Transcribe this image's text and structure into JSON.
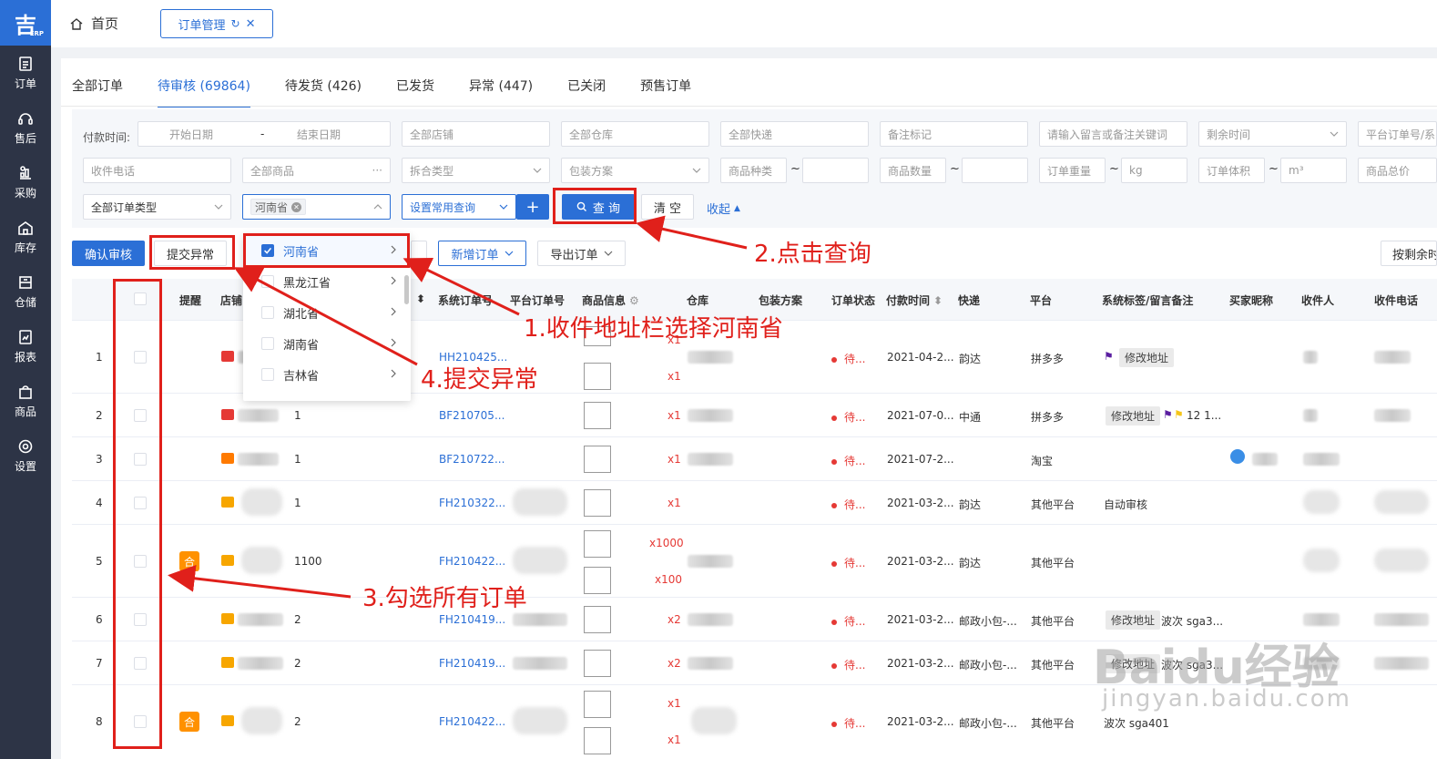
{
  "sidebar": {
    "logo": "吉",
    "logo_sub": "ERP",
    "items": [
      {
        "label": "订单",
        "icon": "order-icon"
      },
      {
        "label": "售后",
        "icon": "headset-icon"
      },
      {
        "label": "采购",
        "icon": "purchase-icon"
      },
      {
        "label": "库存",
        "icon": "warehouse-icon"
      },
      {
        "label": "仓储",
        "icon": "storage-icon"
      },
      {
        "label": "报表",
        "icon": "report-icon"
      },
      {
        "label": "商品",
        "icon": "goods-icon"
      },
      {
        "label": "设置",
        "icon": "settings-icon"
      }
    ]
  },
  "header": {
    "home": "首页",
    "open_tab": "订单管理"
  },
  "tabs": [
    "全部订单",
    "待审核 (69864)",
    "待发货 (426)",
    "已发货",
    "异常 (447)",
    "已关闭",
    "预售订单"
  ],
  "filters": {
    "pay_time_label": "付款时间:",
    "start_date": "开始日期",
    "date_sep": "-",
    "end_date": "结束日期",
    "all_shops": "全部店铺",
    "all_warehouses": "全部仓库",
    "all_express": "全部快递",
    "remark_flag": "备注标记",
    "keyword": "请输入留言或备注关键词",
    "remaining_time": "剩余时间",
    "platform_order": "平台订单号/系",
    "phone": "收件电话",
    "all_goods": "全部商品",
    "split_type": "拆合类型",
    "package_plan": "包装方案",
    "goods_kinds": "商品种类",
    "goods_count": "商品数量",
    "order_weight": "订单重量",
    "weight_unit": "kg",
    "order_volume": "订单体积",
    "volume_unit": "m³",
    "goods_total": "商品总价",
    "tilde": "~",
    "all_order_types": "全部订单类型",
    "province_chip": "河南省",
    "common_query": "设置常用查询",
    "query_btn": "查 询",
    "clear_btn": "清 空",
    "collapse": "收起"
  },
  "actions": {
    "confirm_review": "确认审核",
    "submit_exception": "提交异常",
    "new_order": "新增订单",
    "export_order": "导出订单",
    "by_remaining": "按剩余时"
  },
  "dropdown": {
    "items": [
      "河南省",
      "黑龙江省",
      "湖北省",
      "湖南省",
      "吉林省"
    ]
  },
  "table": {
    "headers": [
      "提醒",
      "店铺",
      "系统订单号",
      "平台订单号",
      "商品信息",
      "仓库",
      "包装方案",
      "订单状态",
      "付款时间",
      "快递",
      "平台",
      "系统标签/留言备注",
      "买家昵称",
      "收件人",
      "收件电话"
    ],
    "rows": [
      {
        "idx": "1",
        "qty": "",
        "sys_no": "HH210425...",
        "counts": [
          "x1",
          "x1"
        ],
        "status": "待...",
        "pay": "2021-04-2...",
        "express": "韵达",
        "platform": "拼多多",
        "tags": "修改地址",
        "merged": false
      },
      {
        "idx": "2",
        "qty": "1",
        "sys_no": "BF210705...",
        "counts": [
          "x1"
        ],
        "status": "待...",
        "pay": "2021-07-0...",
        "express": "中通",
        "platform": "拼多多",
        "tags": "修改地址",
        "tag_extra": "12 1...",
        "merged": false
      },
      {
        "idx": "3",
        "qty": "1",
        "sys_no": "BF210722...",
        "counts": [
          "x1"
        ],
        "status": "待...",
        "pay": "2021-07-2...",
        "express": "",
        "platform": "淘宝",
        "tags": "",
        "merged": false
      },
      {
        "idx": "4",
        "qty": "1",
        "sys_no": "FH210322...",
        "counts": [
          "x1"
        ],
        "status": "待...",
        "pay": "2021-03-2...",
        "express": "韵达",
        "platform": "其他平台",
        "tags": "自动审核",
        "merged": false
      },
      {
        "idx": "5",
        "qty": "1100",
        "sys_no": "FH210422...",
        "counts": [
          "x1000",
          "x100"
        ],
        "status": "待...",
        "pay": "2021-03-2...",
        "express": "韵达",
        "platform": "其他平台",
        "tags": "",
        "merged": true
      },
      {
        "idx": "6",
        "qty": "2",
        "sys_no": "FH210419...",
        "counts": [
          "x2"
        ],
        "status": "待...",
        "pay": "2021-03-2...",
        "express": "邮政小包-...",
        "platform": "其他平台",
        "tags": "修改地址",
        "tag_extra": "波次 sga3...",
        "merged": false
      },
      {
        "idx": "7",
        "qty": "2",
        "sys_no": "FH210419...",
        "counts": [
          "x2"
        ],
        "status": "待...",
        "pay": "2021-03-2...",
        "express": "邮政小包-...",
        "platform": "其他平台",
        "tags": "修改地址",
        "tag_extra": "波次 sga3...",
        "merged": false
      },
      {
        "idx": "8",
        "qty": "2",
        "sys_no": "FH210422...",
        "counts": [
          "x1",
          "x1"
        ],
        "status": "待...",
        "pay": "2021-03-2...",
        "express": "邮政小包-...",
        "platform": "其他平台",
        "tags": "",
        "tag_extra": "波次 sga401",
        "merged": true
      }
    ],
    "merge_badge": "合"
  },
  "annotations": {
    "step1": "1.收件地址栏选择河南省",
    "step2": "2.点击查询",
    "step3": "3.勾选所有订单",
    "step4": "4.提交异常"
  },
  "watermark": {
    "main": "Baidu经验",
    "sub": "jingyan.baidu.com"
  },
  "colors": {
    "accent": "#2b6fd6",
    "sidebar": "#2d3446",
    "annotation": "#e0201b",
    "badge": "#ff9100"
  }
}
